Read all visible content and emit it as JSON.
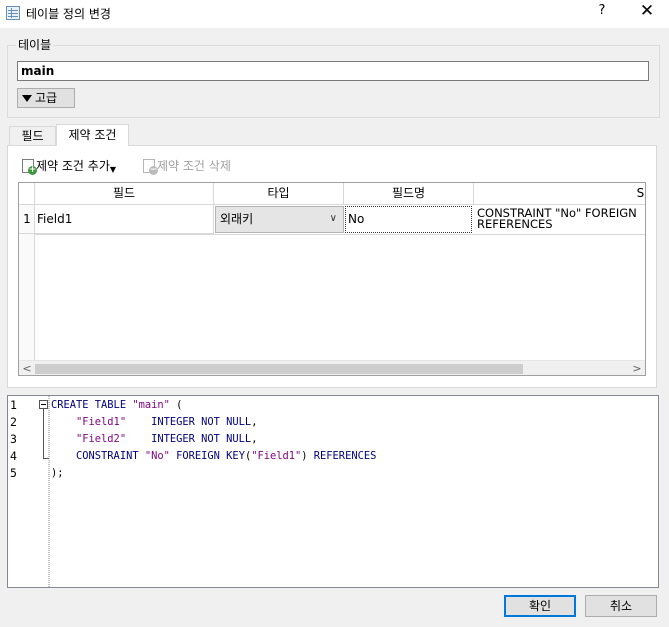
{
  "window": {
    "title": "테이블 정의 변경",
    "help": "?",
    "close": "✕"
  },
  "table_group": {
    "label": "테이블",
    "name_value": "main",
    "advanced_label": "고급"
  },
  "tabs": [
    {
      "label": "필드",
      "active": false
    },
    {
      "label": "제약 조건",
      "active": true
    }
  ],
  "toolbar": {
    "add_label": "제약 조건 추가",
    "delete_label": "제약 조건 삭제"
  },
  "grid": {
    "columns": [
      "필드",
      "타입",
      "필드명",
      "SQL"
    ],
    "rows": [
      {
        "num": "1",
        "field": "Field1",
        "type": "외래키",
        "name": "No",
        "sql_line1": "CONSTRAINT \"No\" FOREIGN",
        "sql_line2": "REFERENCES"
      }
    ]
  },
  "sql_editor": {
    "line_numbers": [
      "1",
      "2",
      "3",
      "4",
      "5"
    ],
    "lines": {
      "l1_kw": "CREATE TABLE ",
      "l1_str": "\"main\"",
      "l1_end": " (",
      "l2_str": "    \"Field1\"",
      "l2_kw": "    INTEGER NOT NULL",
      "l2_end": ",",
      "l3_str": "    \"Field2\"",
      "l3_kw": "    INTEGER NOT NULL",
      "l3_end": ",",
      "l4_kw1": "    CONSTRAINT ",
      "l4_str1": "\"No\"",
      "l4_kw2": " FOREIGN KEY",
      "l4_p1": "(",
      "l4_str2": "\"Field1\"",
      "l4_p2": ")",
      "l4_kw3": " REFERENCES",
      "l5": ");"
    }
  },
  "buttons": {
    "ok": "확인",
    "cancel": "취소"
  }
}
